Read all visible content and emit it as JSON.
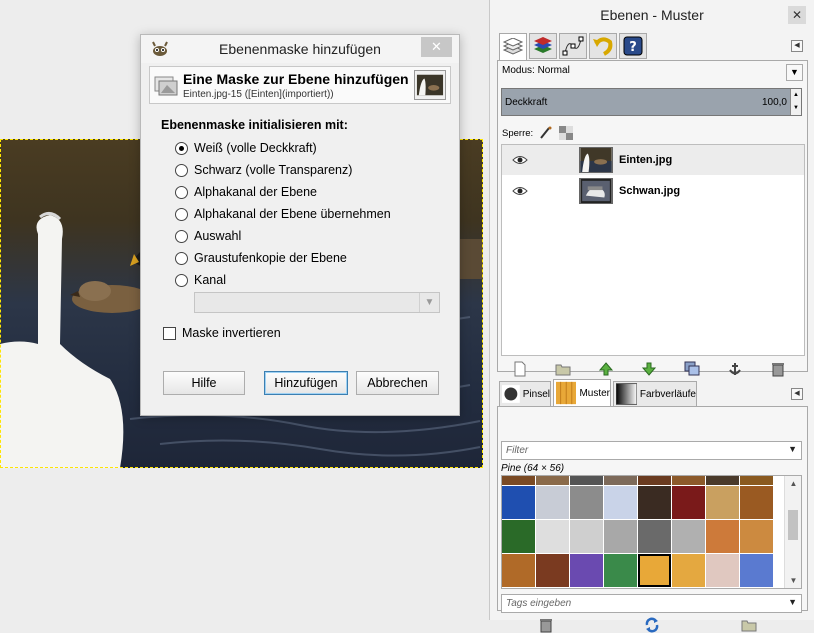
{
  "dialog": {
    "title": "Ebenenmaske hinzufügen",
    "close": "✕",
    "header_title": "Eine Maske zur Ebene hinzufügen",
    "header_subtitle": "Einten.jpg-15 ([Einten](importiert))",
    "section_label": "Ebenenmaske initialisieren mit:",
    "options": [
      {
        "label": "Weiß (volle Deckkraft)",
        "selected": true
      },
      {
        "label": "Schwarz (volle Transparenz)",
        "selected": false
      },
      {
        "label": "Alphakanal der Ebene",
        "selected": false
      },
      {
        "label": "Alphakanal der Ebene übernehmen",
        "selected": false
      },
      {
        "label": "Auswahl",
        "selected": false
      },
      {
        "label": "Graustufenkopie der Ebene",
        "selected": false
      },
      {
        "label": "Kanal",
        "selected": false
      }
    ],
    "invert_label": "Maske invertieren",
    "invert_checked": false,
    "buttons": {
      "help": "Hilfe",
      "add": "Hinzufügen",
      "cancel": "Abbrechen"
    }
  },
  "dock": {
    "title": "Ebenen - Muster",
    "close": "✕",
    "mode_label": "Modus: Normal",
    "opacity_label": "Deckkraft",
    "opacity_value": "100,0",
    "lock_label": "Sperre:",
    "layers": [
      {
        "name": "Einten.jpg",
        "visible": true,
        "selected": true
      },
      {
        "name": "Schwan.jpg",
        "visible": true,
        "selected": false
      }
    ],
    "pattern_tabs": [
      {
        "label": "Pinsel",
        "active": false
      },
      {
        "label": "Muster",
        "active": true
      },
      {
        "label": "Farbverläufe",
        "active": false
      }
    ],
    "filter_placeholder": "Filter",
    "pattern_info": "Pine (64 × 56)",
    "tags_placeholder": "Tags eingeben",
    "patterns": [
      [
        "#7a4a24",
        "#8a6a4a",
        "#555",
        "#7d6a5a",
        "#6a3b20",
        "#8c5a2a",
        "#4a3a2a",
        "#8a5a20"
      ],
      [
        "#1f4fb0",
        "#c8ccd6",
        "#8c8c8c",
        "#c9d3e8",
        "#3a2b22",
        "#7a1a1a",
        "#c9a060",
        "#9a5a22"
      ],
      [
        "#2a6a28",
        "#dedede",
        "#cfcfcf",
        "#a8a8a8",
        "#6a6a6a",
        "#b0b0b0",
        "#cd7a3a",
        "#cc8a40"
      ],
      [
        "#b06a28",
        "#7a3a20",
        "#6a4ab0",
        "#3a8a4a",
        "#e8a838",
        "#e4a840",
        "#e0c8c0",
        "#5a7ad0"
      ]
    ],
    "selected_pattern": [
      3,
      4
    ]
  }
}
